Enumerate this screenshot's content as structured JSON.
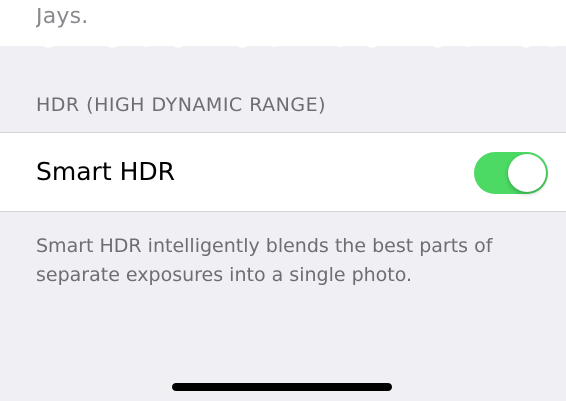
{
  "top_partial_text": "Jays.",
  "section": {
    "header": "HDR (HIGH DYNAMIC RANGE)"
  },
  "smart_hdr": {
    "label": "Smart HDR",
    "enabled": true,
    "toggle_color": "#4cd964"
  },
  "footer": {
    "description": "Smart HDR intelligently blends the best parts of separate exposures into a single photo."
  },
  "colors": {
    "background": "#efeff4",
    "cell": "#ffffff",
    "secondary_text": "#6d6d72"
  }
}
